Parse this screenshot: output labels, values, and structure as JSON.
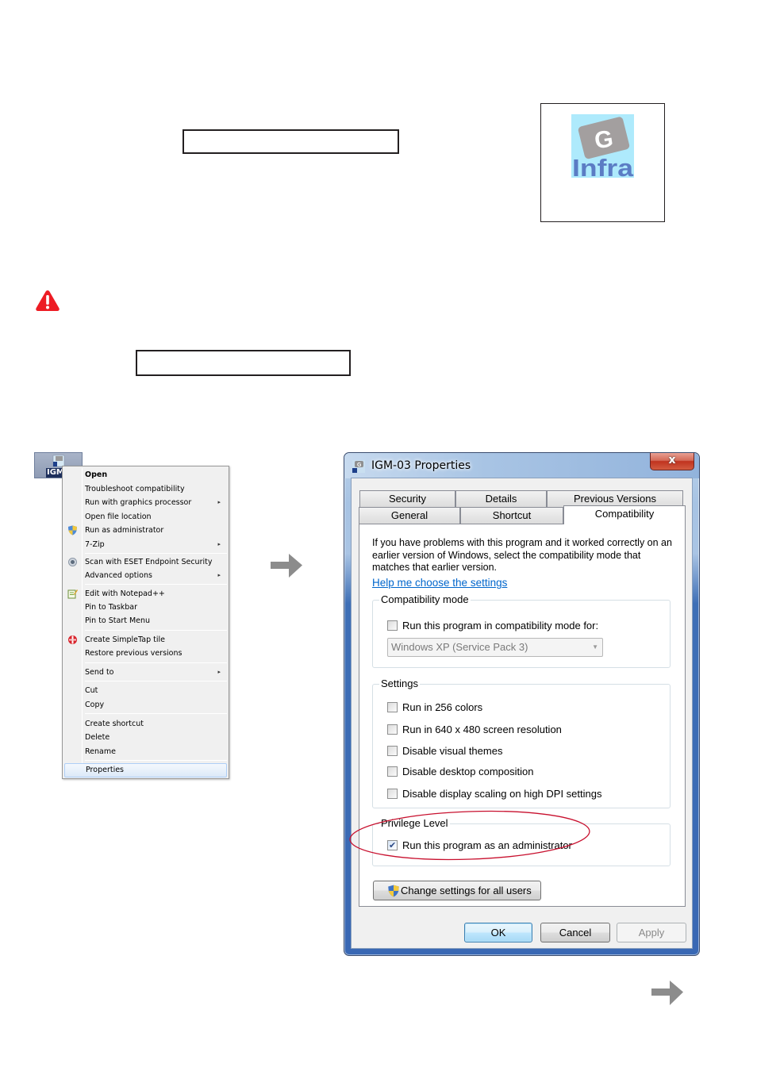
{
  "logo": {
    "letter": "G",
    "word": "Infra",
    "bg_color": "#aeeafc",
    "card_color": "#a39f9f",
    "text_color": "#5b7cc4"
  },
  "warning_icon": {
    "name": "warning-icon",
    "color": "#ed1c24"
  },
  "desktop_icon": {
    "label": "IGM"
  },
  "context_menu": {
    "items": [
      {
        "label": "Open",
        "bold": true
      },
      {
        "label": "Troubleshoot compatibility"
      },
      {
        "label": "Run with graphics processor",
        "submenu": true
      },
      {
        "label": "Open file location"
      },
      {
        "label": "Run as administrator",
        "icon": "uac-shield-icon"
      },
      {
        "label": "7-Zip",
        "submenu": true
      },
      {
        "label": "Scan with ESET Endpoint Security",
        "icon": "eset-icon"
      },
      {
        "label": "Advanced options",
        "submenu": true
      },
      {
        "label": "Edit with Notepad++",
        "icon": "notepad-plus-icon"
      },
      {
        "label": "Pin to Taskbar"
      },
      {
        "label": "Pin to Start Menu"
      },
      {
        "label": "Create SimpleTap tile",
        "icon": "simpletap-icon"
      },
      {
        "label": "Restore previous versions"
      },
      {
        "label": "Send to",
        "submenu": true
      },
      {
        "label": "Cut"
      },
      {
        "label": "Copy"
      },
      {
        "label": "Create shortcut"
      },
      {
        "label": "Delete"
      },
      {
        "label": "Rename"
      },
      {
        "label": "Properties",
        "selected": true
      }
    ],
    "submenu_glyph": "▸"
  },
  "dialog": {
    "title": "IGM-03 Properties",
    "close_glyph": "x",
    "tabs_back": [
      "Security",
      "Details",
      "Previous Versions"
    ],
    "tabs_front": [
      "General",
      "Shortcut",
      "Compatibility"
    ],
    "active_tab": "Compatibility",
    "intro_text": "If you have problems with this program and it worked correctly on an earlier version of Windows, select the compatibility mode that matches that earlier version.",
    "help_link": "Help me choose the settings",
    "compat_group": {
      "label": "Compatibility mode",
      "checkbox": {
        "label": "Run this program in compatibility mode for:",
        "checked": false
      },
      "combo_value": "Windows XP (Service Pack 3)"
    },
    "settings_group": {
      "label": "Settings",
      "checkboxes": [
        {
          "label": "Run in 256 colors",
          "checked": false
        },
        {
          "label": "Run in 640 x 480 screen resolution",
          "checked": false
        },
        {
          "label": "Disable visual themes",
          "checked": false
        },
        {
          "label": "Disable desktop composition",
          "checked": false
        },
        {
          "label": "Disable display scaling on high DPI settings",
          "checked": false
        }
      ]
    },
    "privilege_group": {
      "label": "Privilege Level",
      "checkbox": {
        "label": "Run this program as an administrator",
        "checked": true
      }
    },
    "change_all_users": "Change settings for all users",
    "ok": "OK",
    "cancel": "Cancel",
    "apply": "Apply",
    "highlight_color": "#c8102e"
  },
  "arrow_color": "#8c8c8c"
}
